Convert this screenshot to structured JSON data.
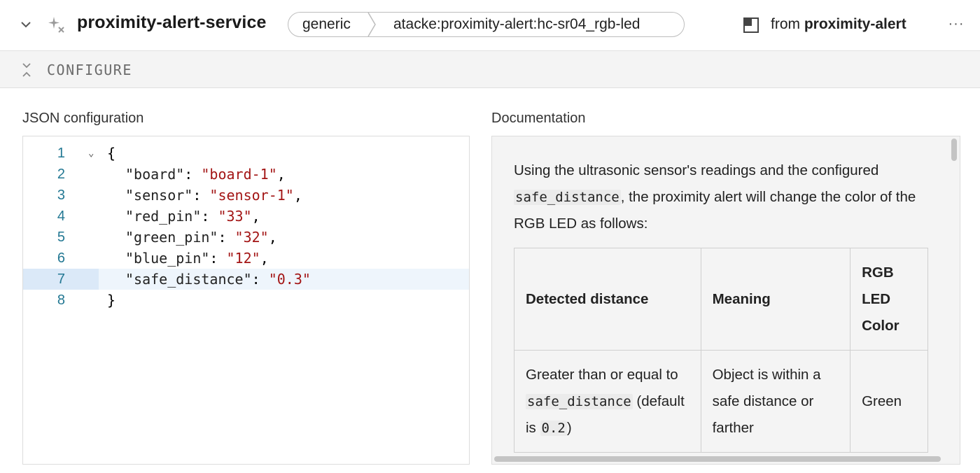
{
  "header": {
    "service_name": "proximity-alert-service",
    "crumb_api": "generic",
    "crumb_model": "atacke:proximity-alert:hc-sr04_rgb-led",
    "from_prefix": "from",
    "from_module": "proximity-alert",
    "more_label": "···",
    "icons": {
      "collapse": "chevron-down-icon",
      "service": "sparkle-service-icon",
      "module": "module-square-icon",
      "more": "more-dots-icon"
    }
  },
  "configure_bar": {
    "label": "CONFIGURE",
    "icon": "collapse-arrows-icon"
  },
  "json_section": {
    "title": "JSON configuration",
    "lines": [
      {
        "num": "1",
        "text": "{"
      },
      {
        "num": "2",
        "key": "\"board\"",
        "value": "\"board-1\""
      },
      {
        "num": "3",
        "key": "\"sensor\"",
        "value": "\"sensor-1\""
      },
      {
        "num": "4",
        "key": "\"red_pin\"",
        "value": "\"33\""
      },
      {
        "num": "5",
        "key": "\"green_pin\"",
        "value": "\"32\""
      },
      {
        "num": "6",
        "key": "\"blue_pin\"",
        "value": "\"12\""
      },
      {
        "num": "7",
        "key": "\"safe_distance\"",
        "value": "\"0.3\""
      },
      {
        "num": "8",
        "text": "}"
      }
    ],
    "active_line": 7,
    "colors": {
      "string": "#a31515",
      "line_number": "#237893",
      "active_line": "#eef5fc"
    }
  },
  "docs_section": {
    "title": "Documentation",
    "intro_a": "Using the ultrasonic sensor's readings and the configured",
    "intro_code": "safe_distance",
    "intro_b": ", the proximity alert will change the color of the RGB LED as follows:",
    "table": {
      "headers": [
        "Detected distance",
        "Meaning",
        "RGB LED Color"
      ],
      "row1": {
        "c1_a": "Greater than or equal to",
        "c1_code": "safe_distance",
        "c1_b": "(default is",
        "c1_code2": "0.2",
        "c1_c": ")",
        "c2": "Object is within a safe distance or farther",
        "c3": "Green"
      }
    }
  }
}
